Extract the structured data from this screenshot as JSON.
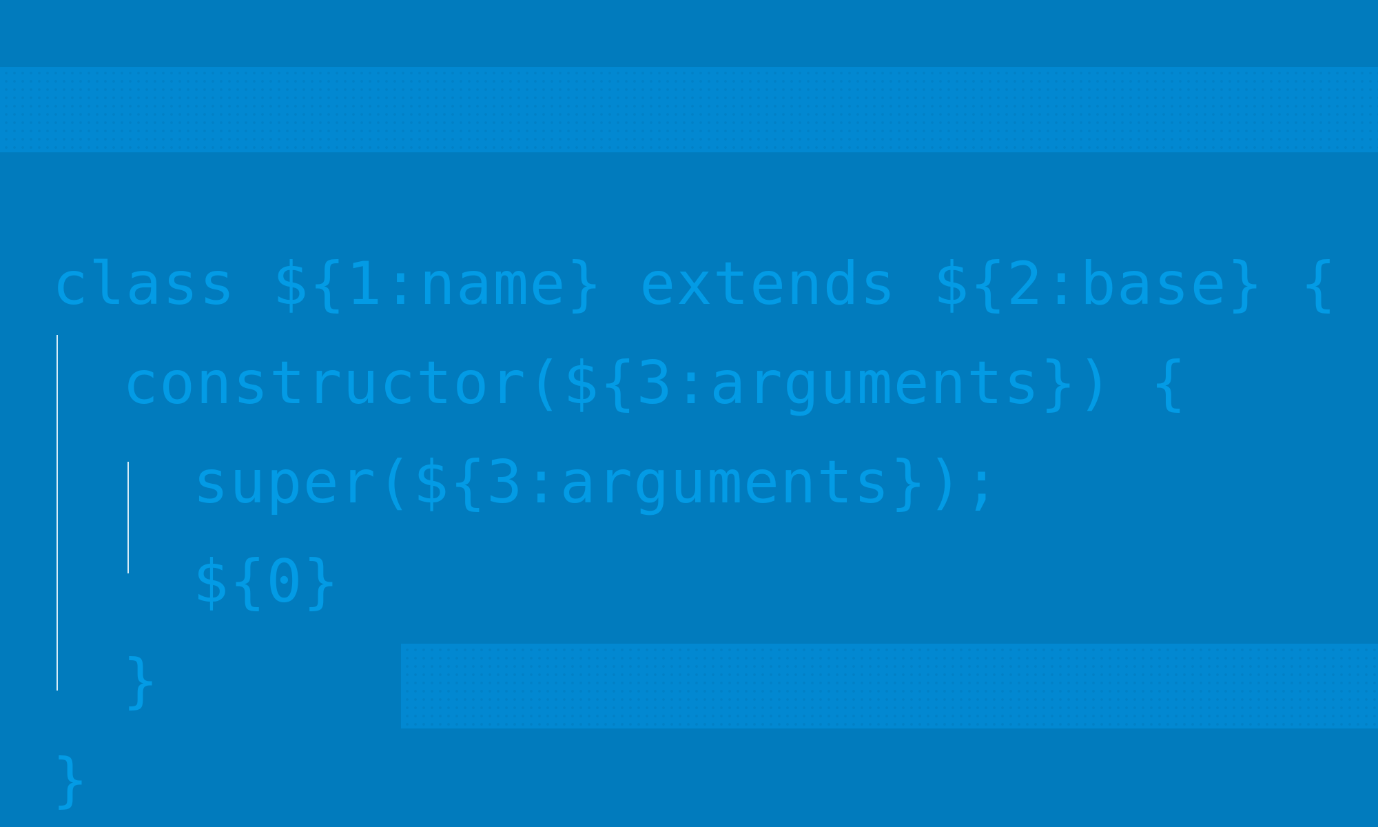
{
  "snippet": {
    "lines": [
      "class ${1:name} extends ${2:base} {",
      "constructor(${3:arguments}) {",
      "super(${3:arguments});",
      "${0}",
      "}",
      "}"
    ]
  },
  "colors": {
    "background": "#017bbd",
    "band": "#0288d1",
    "code_text": "#039be5",
    "indent_guide": "#d6ecf8"
  }
}
